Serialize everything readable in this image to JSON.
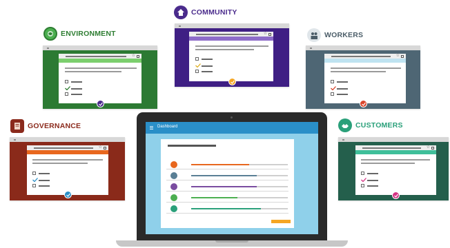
{
  "categories": {
    "community": {
      "label": "COMMUNITY",
      "color": "#4a2b8c",
      "icon": "community-icon"
    },
    "environment": {
      "label": "ENVIRONMENT",
      "color": "#2e7d32",
      "icon": "environment-icon"
    },
    "workers": {
      "label": "WORKERS",
      "color": "#4b5d68",
      "icon": "workers-icon"
    },
    "governance": {
      "label": "GOVERNANCE",
      "color": "#8b2a1c",
      "icon": "governance-icon"
    },
    "customers": {
      "label": "CUSTOMERS",
      "color": "#2aa07a",
      "icon": "customers-icon"
    }
  },
  "laptop": {
    "app_title": "Dashboard",
    "rows": [
      {
        "icon": "governance-icon",
        "color": "#e8671e",
        "progress": 0.6
      },
      {
        "icon": "workers-icon",
        "color": "#5a7f95",
        "progress": 0.68
      },
      {
        "icon": "community-icon",
        "color": "#7a4ca0",
        "progress": 0.68
      },
      {
        "icon": "environment-icon",
        "color": "#4caf50",
        "progress": 0.48
      },
      {
        "icon": "customers-icon",
        "color": "#2aa07a",
        "progress": 0.72
      }
    ]
  },
  "colors": {
    "community_frame": "#3f1f84",
    "community_accent": "#8e6cc9",
    "environment_frame": "#2c7a33",
    "environment_accent": "#7ccf6e",
    "workers_frame": "#4e6674",
    "workers_accent": "#bfe3f1",
    "governance_frame": "#8a2a1a",
    "governance_accent": "#e8671e",
    "customers_frame": "#245f4c",
    "customers_accent": "#3fbf9a",
    "laptop_bar": "#2a8fc8",
    "button": "#f5a623"
  }
}
